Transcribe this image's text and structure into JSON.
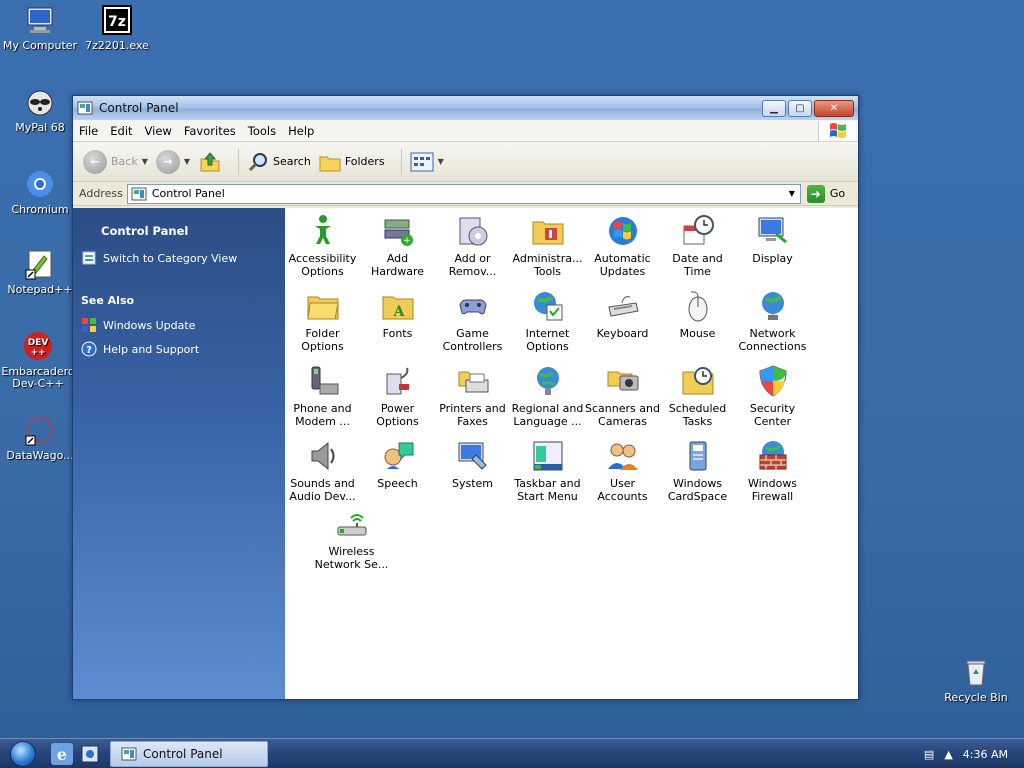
{
  "desktop": {
    "icons": [
      {
        "label": "My Computer"
      },
      {
        "label": "7z2201.exe"
      },
      {
        "label": "MyPal 68"
      },
      {
        "label": "Chromium"
      },
      {
        "label": "Notepad++"
      },
      {
        "label": "Embarcadero Dev-C++"
      },
      {
        "label": "DataWago..."
      },
      {
        "label": "Recycle Bin"
      }
    ]
  },
  "window": {
    "title": "Control Panel",
    "menu": [
      "File",
      "Edit",
      "View",
      "Favorites",
      "Tools",
      "Help"
    ],
    "toolbar": {
      "back": "Back",
      "search": "Search",
      "folders": "Folders"
    },
    "address": {
      "label": "Address",
      "value": "Control Panel",
      "go": "Go"
    }
  },
  "sidepane": {
    "title": "Control Panel",
    "switch_view": "Switch to Category View",
    "see_also": "See Also",
    "links": [
      "Windows Update",
      "Help and Support"
    ]
  },
  "items": [
    {
      "label": "Accessibility Options"
    },
    {
      "label": "Add Hardware"
    },
    {
      "label": "Add or Remov..."
    },
    {
      "label": "Administra... Tools"
    },
    {
      "label": "Automatic Updates"
    },
    {
      "label": "Date and Time"
    },
    {
      "label": "Display"
    },
    {
      "label": "Folder Options"
    },
    {
      "label": "Fonts"
    },
    {
      "label": "Game Controllers"
    },
    {
      "label": "Internet Options"
    },
    {
      "label": "Keyboard"
    },
    {
      "label": "Mouse"
    },
    {
      "label": "Network Connections"
    },
    {
      "label": "Phone and Modem ..."
    },
    {
      "label": "Power Options"
    },
    {
      "label": "Printers and Faxes"
    },
    {
      "label": "Regional and Language ..."
    },
    {
      "label": "Scanners and Cameras"
    },
    {
      "label": "Scheduled Tasks"
    },
    {
      "label": "Security Center"
    },
    {
      "label": "Sounds and Audio Dev..."
    },
    {
      "label": "Speech"
    },
    {
      "label": "System"
    },
    {
      "label": "Taskbar and Start Menu"
    },
    {
      "label": "User Accounts"
    },
    {
      "label": "Windows CardSpace"
    },
    {
      "label": "Windows Firewall"
    },
    {
      "label": "Wireless Network Se..."
    }
  ],
  "taskbar": {
    "task": "Control Panel",
    "clock": "4:36 AM"
  }
}
